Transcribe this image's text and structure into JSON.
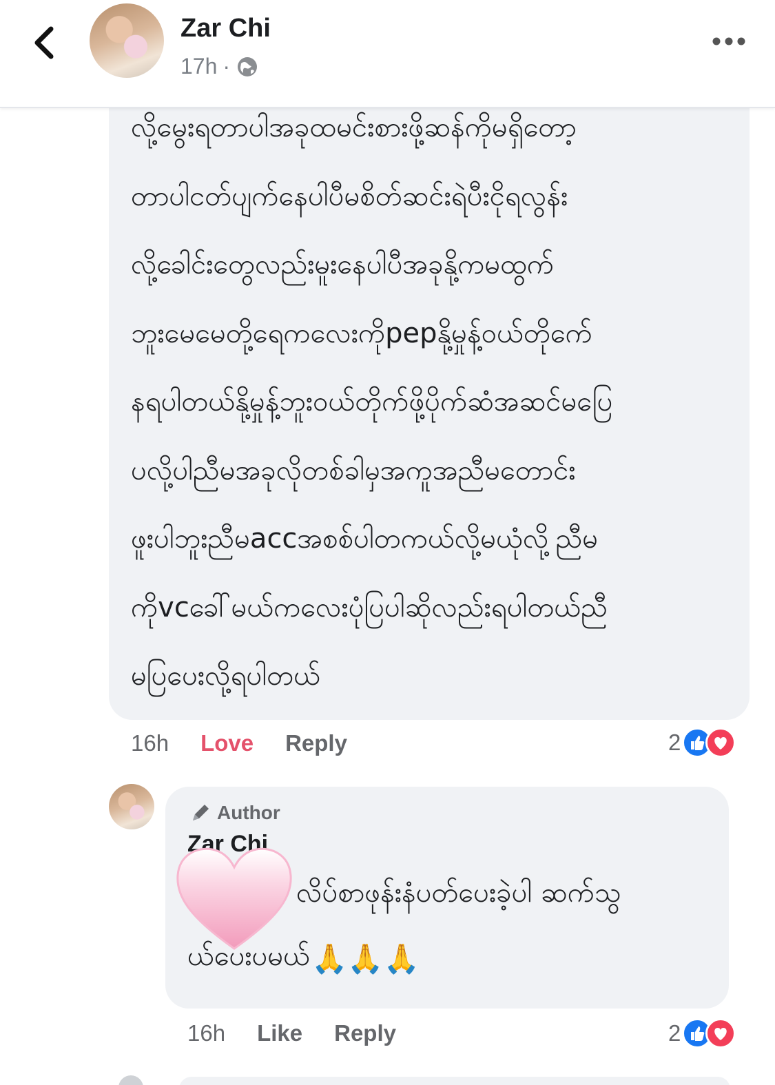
{
  "header": {
    "author": "Zar Chi",
    "time": "17h",
    "separator": "·"
  },
  "comment": {
    "lines": [
      "လို့မွေးရတာပါအခုထမင်းစားဖို့ဆန်ကိုမရှိတော့",
      "တာပါငတ်ပျက်နေပါပီမစိတ်ဆင်းရဲပီးငိုရလွန်း",
      "လို့ခေါင်းတွေလည်းမူးနေပါပီအခုနို့ကမထွက်",
      "ဘူးမေမေတို့ရေကလေးကိုpepနို့မှုန့်ဝယ်တိုက်ေ",
      "နရပါတယ်နို့မှုန့်ဘူးဝယ်တိုက်ဖို့ပိုက်ဆံအဆင်မပြေ",
      "ပလို့ပါညီမအခုလိုတစ်ခါမှအကူအညီမတောင်း",
      "ဖူးပါဘူးညီမaccအစစ်ပါတကယ်လို့မယုံလို့ညီမ",
      "ကိုvcခေါ်မယ်ကလေးပုံပြပါဆိုလည်းရပါတယ်ညီ",
      "မပြပေးလို့ရပါတယ်"
    ],
    "time": "16h",
    "reaction_label": "Love",
    "reply_label": "Reply",
    "reaction_count": "2",
    "love_color": "#e4526b"
  },
  "reply": {
    "badge": "Author",
    "name": "Zar Chi",
    "line1": "လိပ်စာဖုန်းနံပတ်ပေးခဲ့ပါ ဆက်သွ",
    "line2": "ယ်ပေးပမယ်",
    "emoji": "🙏🙏🙏",
    "time": "16h",
    "like_label": "Like",
    "reply_label": "Reply",
    "reaction_count": "2"
  }
}
